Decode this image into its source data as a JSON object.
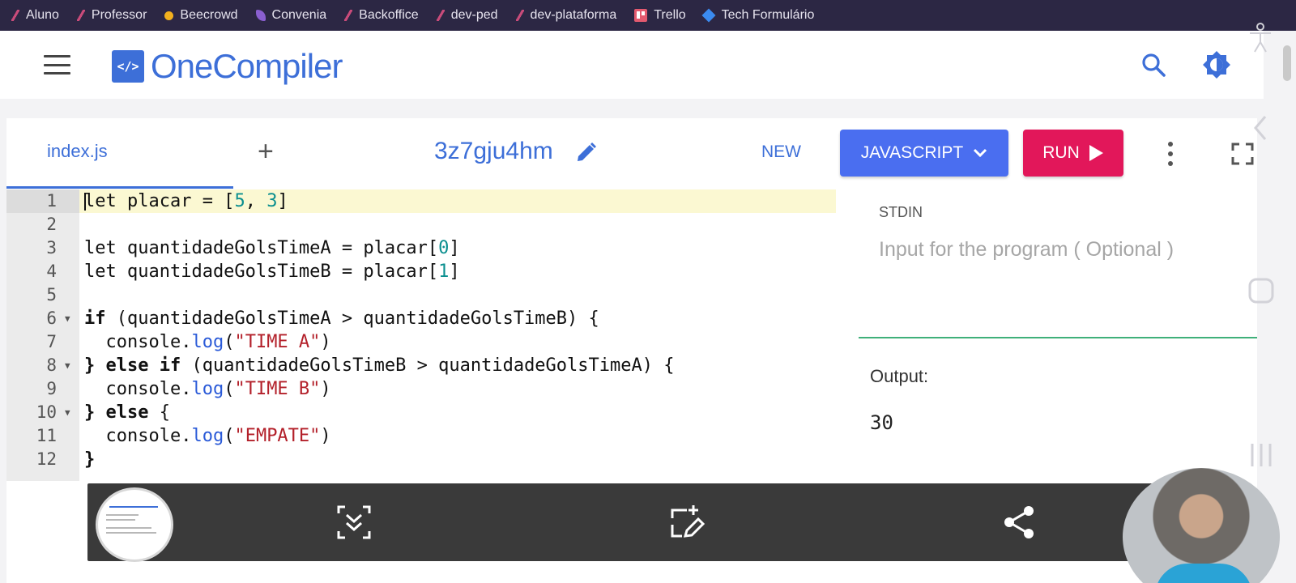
{
  "bookmarks": [
    {
      "label": "Aluno",
      "icon": "slash-icon"
    },
    {
      "label": "Professor",
      "icon": "slash-icon"
    },
    {
      "label": "Beecrowd",
      "icon": "dot-icon"
    },
    {
      "label": "Convenia",
      "icon": "leaf-icon"
    },
    {
      "label": "Backoffice",
      "icon": "slash-icon"
    },
    {
      "label": "dev-ped",
      "icon": "slash-icon"
    },
    {
      "label": "dev-plataforma",
      "icon": "slash-icon"
    },
    {
      "label": "Trello",
      "icon": "trello-icon"
    },
    {
      "label": "Tech Formulário",
      "icon": "diamond-icon"
    }
  ],
  "header": {
    "logo_mark": "</>",
    "brand": "OneCompiler",
    "accent_color": "#3d6fd8"
  },
  "toolbar": {
    "file_tab": "index.js",
    "add_tab": "+",
    "code_id": "3z7gju4hm",
    "new_label": "NEW",
    "language_label": "JAVASCRIPT",
    "run_label": "RUN",
    "language_color": "#4a6ef0",
    "run_color": "#e2175a"
  },
  "editor": {
    "lines": [
      {
        "n": "1"
      },
      {
        "n": "2"
      },
      {
        "n": "3"
      },
      {
        "n": "4"
      },
      {
        "n": "5"
      },
      {
        "n": "6"
      },
      {
        "n": "7"
      },
      {
        "n": "8"
      },
      {
        "n": "9"
      },
      {
        "n": "10"
      },
      {
        "n": "11"
      },
      {
        "n": "12"
      }
    ],
    "tokens": {
      "l1_a": "let placar = [",
      "l1_b": "5",
      "l1_c": ", ",
      "l1_d": "3",
      "l1_e": "]",
      "l3_a": "let quantidadeGolsTimeA = placar[",
      "l3_b": "0",
      "l3_c": "]",
      "l4_a": "let quantidadeGolsTimeB = placar[",
      "l4_b": "1",
      "l4_c": "]",
      "l6_kw": "if",
      "l6_rest": " (quantidadeGolsTimeA > quantidadeGolsTimeB) {",
      "l7_a": "  console.",
      "l7_fn": "log",
      "l7_b": "(",
      "l7_str": "\"TIME A\"",
      "l7_c": ")",
      "l8_a": "} ",
      "l8_kw": "else if",
      "l8_rest": " (quantidadeGolsTimeB > quantidadeGolsTimeA) {",
      "l9_a": "  console.",
      "l9_fn": "log",
      "l9_b": "(",
      "l9_str": "\"TIME B\"",
      "l9_c": ")",
      "l10_a": "} ",
      "l10_kw": "else",
      "l10_rest": " {",
      "l11_a": "  console.",
      "l11_fn": "log",
      "l11_b": "(",
      "l11_str": "\"EMPATE\"",
      "l11_c": ")",
      "l12_a": "}"
    },
    "fold_marker": "▼"
  },
  "stdin": {
    "label": "STDIN",
    "placeholder": "Input for the program ( Optional )"
  },
  "output": {
    "label": "Output:",
    "value": "30"
  },
  "overlay": {
    "actions": [
      "scroll-capture-icon",
      "crop-edit-icon",
      "share-icon"
    ]
  }
}
